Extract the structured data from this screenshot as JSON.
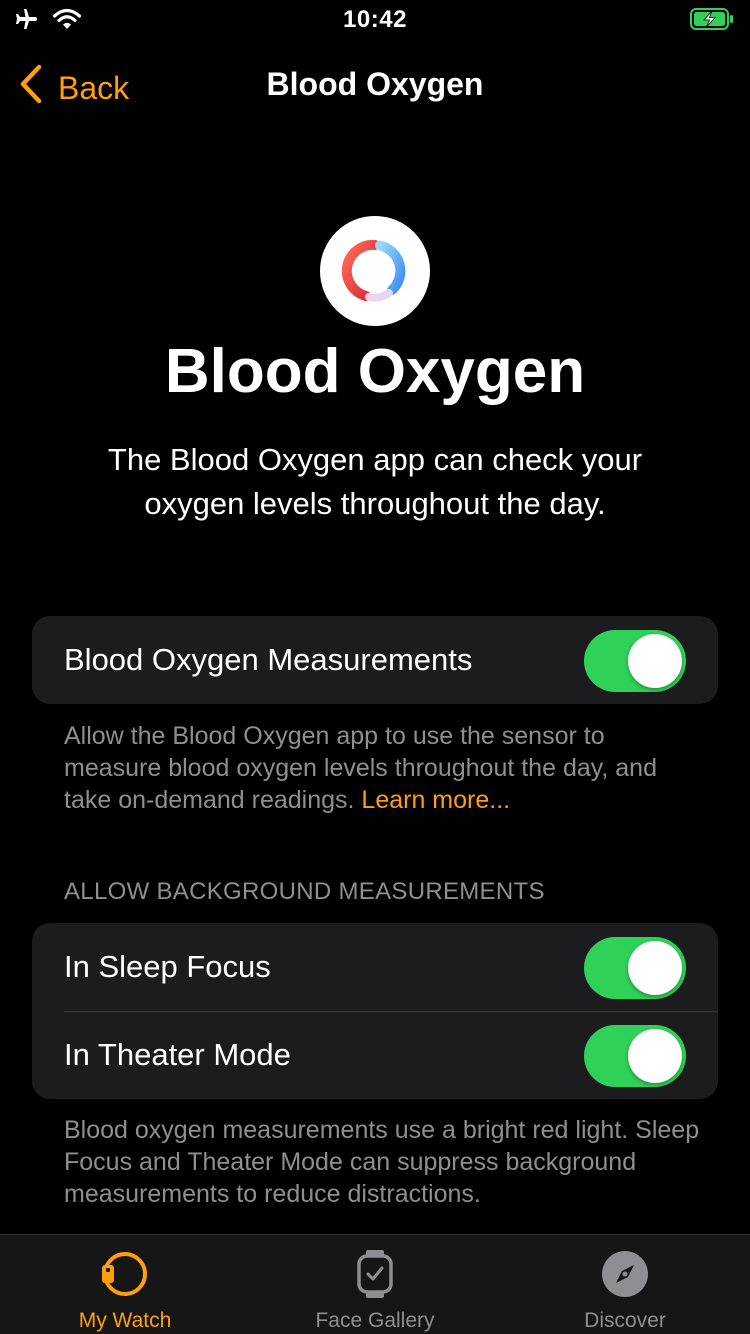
{
  "status_bar": {
    "time": "10:42",
    "icons": [
      "airplane-icon",
      "wifi-icon",
      "battery-charging-icon"
    ]
  },
  "nav": {
    "back_label": "Back",
    "title": "Blood Oxygen"
  },
  "hero": {
    "icon": "blood-oxygen-app-icon",
    "title": "Blood Oxygen",
    "description": "The Blood Oxygen app can check your oxygen levels throughout the day."
  },
  "measurements": {
    "label": "Blood Oxygen Measurements",
    "enabled": true,
    "footnote": "Allow the Blood Oxygen app to use the sensor to measure blood oxygen levels throughout the day, and take on-demand readings.",
    "learn_more": "Learn more..."
  },
  "background": {
    "header": "ALLOW BACKGROUND MEASUREMENTS",
    "rows": [
      {
        "label": "In Sleep Focus",
        "enabled": true
      },
      {
        "label": "In Theater Mode",
        "enabled": true
      }
    ],
    "footnote": "Blood oxygen measurements use a bright red light. Sleep Focus and Theater Mode can suppress background measurements to reduce distractions."
  },
  "tab_bar": {
    "tabs": [
      {
        "label": "My Watch",
        "icon": "my-watch-icon",
        "active": true
      },
      {
        "label": "Face Gallery",
        "icon": "face-gallery-icon",
        "active": false
      },
      {
        "label": "Discover",
        "icon": "compass-icon",
        "active": false
      }
    ]
  },
  "colors": {
    "accent": "#ff9f0a",
    "toggle_on": "#30d158",
    "group_bg": "#1c1c1e",
    "secondary_text": "#8e8e93"
  }
}
